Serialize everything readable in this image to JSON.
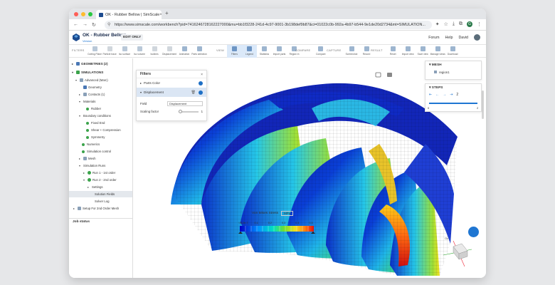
{
  "browser": {
    "tab_title": "OK - Rubber Bellow | SimScale",
    "url": "https://www.simscale.com/workbench?pid=7416246728162227000&mu=bb1f3228-241d-4c97-9001-3b198def9b87&ci=01022c0b-992a-4b97-b544-9e1de20d2734&mt=SIMULATION..."
  },
  "app": {
    "project_title": "OK - Rubber Bellow",
    "project_subtitle": "Version",
    "edit_badge": "EDIT ONLY",
    "header_links": [
      "Forum",
      "Help",
      "David"
    ]
  },
  "toolbar": {
    "groups": [
      {
        "label": "FILTERS",
        "items": [
          "Cutting Plane",
          "Particle trace",
          "Iso surface",
          "Iso volume",
          "Isolines",
          "Displacement",
          "Animation",
          "Parts selection"
        ]
      },
      {
        "label": "VIEW",
        "items": [
          "Filters",
          "Legend",
          "Statistics",
          "Import parts",
          "Region in"
        ]
      },
      {
        "label": "COMPARE",
        "items": [
          "Compare"
        ]
      },
      {
        "label": "CAPTURE",
        "items": [
          "Screenshot",
          "Record"
        ]
      },
      {
        "label": "RESULT",
        "items": [
          "Reset",
          "Import view",
          "Save view",
          "Manage views",
          "Download"
        ]
      }
    ]
  },
  "tree": {
    "items": [
      {
        "label": "GEOMETRIES (2)",
        "level": 0,
        "type": "section"
      },
      {
        "label": "SIMULATIONS",
        "level": 0,
        "type": "section"
      },
      {
        "label": "Advanced (Marc)",
        "level": 1
      },
      {
        "label": "Geometry",
        "level": 2
      },
      {
        "label": "Contacts (1)",
        "level": 2
      },
      {
        "label": "Materials",
        "level": 2
      },
      {
        "label": "Rubber",
        "level": 3,
        "check": true
      },
      {
        "label": "Boundary conditions",
        "level": 2
      },
      {
        "label": "Fixed End",
        "level": 3,
        "check": true
      },
      {
        "label": "Shear + Compression",
        "level": 3,
        "check": true
      },
      {
        "label": "Symmetry",
        "level": 3,
        "check": true
      },
      {
        "label": "Numerics",
        "level": 2,
        "check": true
      },
      {
        "label": "Simulation control",
        "level": 2,
        "check": true
      },
      {
        "label": "Mesh",
        "level": 2
      },
      {
        "label": "Simulation Runs",
        "level": 2
      },
      {
        "label": "Run 1 - 1st order",
        "level": 3
      },
      {
        "label": "Run 2 - 2nd order",
        "level": 3
      },
      {
        "label": "Settings",
        "level": 4
      },
      {
        "label": "Solution Fields",
        "level": 4,
        "highlight": true
      },
      {
        "label": "Solver Log",
        "level": 4
      },
      {
        "label": "Setup For 2nd Order Mesh",
        "level": 1
      }
    ],
    "job_status": "Job status"
  },
  "filters_panel": {
    "title": "Filters",
    "rows": [
      "Parts Color",
      "Displacement"
    ],
    "field_label": "Field",
    "field_value": "Displacement",
    "scaling_label": "Scaling factor",
    "scaling_value": "1"
  },
  "right_panel": {
    "mesh_title": "MESH",
    "mesh_item": "region1",
    "steps_title": "STEPS",
    "step_value": "2",
    "step_min": "0",
    "step_max": "2"
  },
  "legend": {
    "title": "Von Mises Stress",
    "unit": "MPa",
    "ticks": [
      "2.912e-7",
      "0.1",
      "0.2",
      "0.3",
      "0.4",
      "0.5"
    ]
  }
}
